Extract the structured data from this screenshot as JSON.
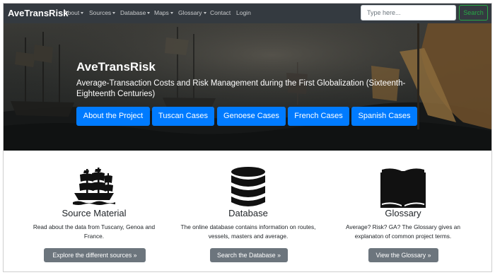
{
  "navbar": {
    "brand": "AveTransRisk",
    "items": [
      {
        "label": "About",
        "dropdown": true
      },
      {
        "label": "Sources",
        "dropdown": true
      },
      {
        "label": "Database",
        "dropdown": true
      },
      {
        "label": "Maps",
        "dropdown": true
      },
      {
        "label": "Glossary",
        "dropdown": true
      },
      {
        "label": "Contact",
        "dropdown": false
      },
      {
        "label": "Login",
        "dropdown": false
      }
    ],
    "search_placeholder": "Type here...",
    "search_button": "Search"
  },
  "hero": {
    "title": "AveTransRisk",
    "subtitle": "Average-Transaction Costs and Risk Management during the First Globalization (Sixteenth-Eighteenth Centuries)",
    "buttons": [
      "About the Project",
      "Tuscan Cases",
      "Genoese Cases",
      "French Cases",
      "Spanish Cases"
    ]
  },
  "features": [
    {
      "icon": "ship-icon",
      "title": "Source Material",
      "text": "Read about the data from Tuscany, Genoa and France.",
      "button": "Explore the different sources »"
    },
    {
      "icon": "database-icon",
      "title": "Database",
      "text": "The online database contains information on routes, vessels, masters and average.",
      "button": "Search the Database »"
    },
    {
      "icon": "book-icon",
      "title": "Glossary",
      "text": "Average? Risk? GA? The Glossary gives an explanaton of common project terms.",
      "button": "View the Glossary »"
    }
  ],
  "colors": {
    "navbar_bg": "#343a40",
    "primary": "#007bff",
    "success": "#28a745",
    "secondary": "#6c757d"
  }
}
